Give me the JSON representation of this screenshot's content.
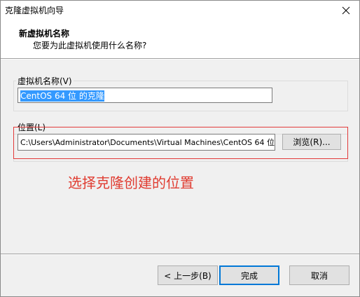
{
  "window": {
    "title": "克隆虚拟机向导",
    "close_icon": "close-icon"
  },
  "header": {
    "title": "新虚拟机名称",
    "subtitle": "您要为此虚拟机使用什么名称?"
  },
  "vm_name": {
    "label": "虚拟机名称(V)",
    "value": "CentOS 64 位 的克隆"
  },
  "location": {
    "label": "位置(L)",
    "value": "C:\\Users\\Administrator\\Documents\\Virtual Machines\\CentOS 64 位",
    "browse_label": "浏览(R)..."
  },
  "annotation": {
    "text": "选择克隆创建的位置",
    "color": "#e03c31"
  },
  "footer": {
    "back_label": "< 上一步(B)",
    "finish_label": "完成",
    "cancel_label": "取消"
  }
}
